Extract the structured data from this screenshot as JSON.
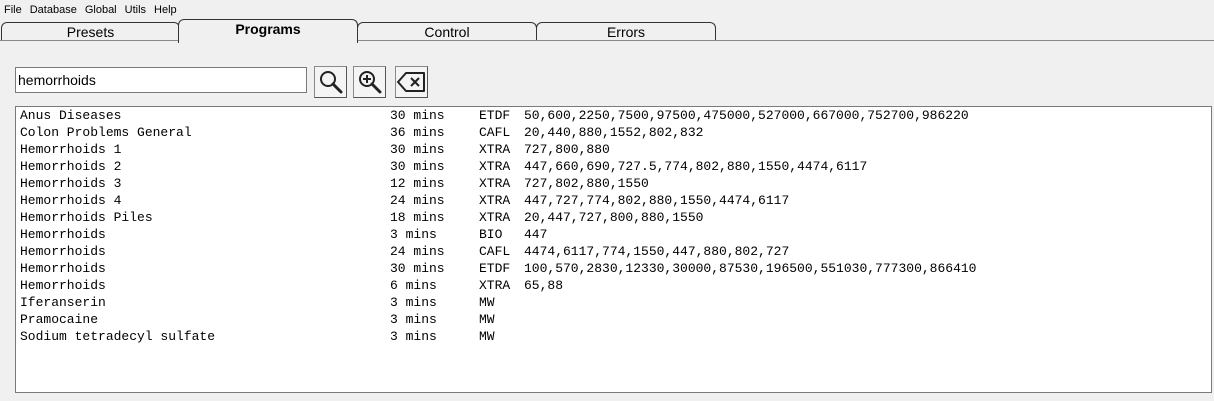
{
  "menu": [
    "File",
    "Database",
    "Global",
    "Utils",
    "Help"
  ],
  "tabs": [
    "Presets",
    "Programs",
    "Control",
    "Errors"
  ],
  "active_tab": "Programs",
  "search": {
    "value": "hemorrhoids"
  },
  "toolbar": {
    "search_icon": "magnifier-icon",
    "zoom_icon": "zoom-in-icon",
    "clear_icon": "backspace-clear-icon"
  },
  "results": [
    {
      "name": "Anus Diseases",
      "duration": "30 mins",
      "type": "ETDF",
      "freqs": "50,600,2250,7500,97500,475000,527000,667000,752700,986220"
    },
    {
      "name": "Colon Problems General",
      "duration": "36 mins",
      "type": "CAFL",
      "freqs": "20,440,880,1552,802,832"
    },
    {
      "name": "Hemorrhoids 1",
      "duration": "30 mins",
      "type": "XTRA",
      "freqs": "727,800,880"
    },
    {
      "name": "Hemorrhoids 2",
      "duration": "30 mins",
      "type": "XTRA",
      "freqs": "447,660,690,727.5,774,802,880,1550,4474,6117"
    },
    {
      "name": "Hemorrhoids 3",
      "duration": "12 mins",
      "type": "XTRA",
      "freqs": "727,802,880,1550"
    },
    {
      "name": "Hemorrhoids 4",
      "duration": "24 mins",
      "type": "XTRA",
      "freqs": "447,727,774,802,880,1550,4474,6117"
    },
    {
      "name": "Hemorrhoids Piles",
      "duration": "18 mins",
      "type": "XTRA",
      "freqs": "20,447,727,800,880,1550"
    },
    {
      "name": "Hemorrhoids",
      "duration": "3 mins",
      "type": "BIO",
      "freqs": "447"
    },
    {
      "name": "Hemorrhoids",
      "duration": "24 mins",
      "type": "CAFL",
      "freqs": "4474,6117,774,1550,447,880,802,727"
    },
    {
      "name": "Hemorrhoids",
      "duration": "30 mins",
      "type": "ETDF",
      "freqs": "100,570,2830,12330,30000,87530,196500,551030,777300,866410"
    },
    {
      "name": "Hemorrhoids",
      "duration": "6 mins",
      "type": "XTRA",
      "freqs": "65,88"
    },
    {
      "name": "Iferanserin",
      "duration": "3 mins",
      "type": "MW",
      "freqs": ""
    },
    {
      "name": "Pramocaine",
      "duration": "3 mins",
      "type": "MW",
      "freqs": ""
    },
    {
      "name": "Sodium tetradecyl sulfate",
      "duration": "3 mins",
      "type": "MW",
      "freqs": ""
    }
  ]
}
